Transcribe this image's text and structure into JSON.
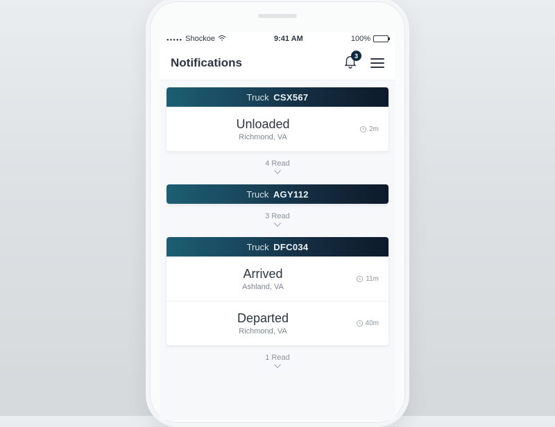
{
  "statusbar": {
    "carrier": "Shockoe",
    "time": "9:41 AM",
    "battery": "100%"
  },
  "nav": {
    "title": "Notifications",
    "badge": "3"
  },
  "truck_prefix": "Truck",
  "groups": [
    {
      "code": "CSX567",
      "items": [
        {
          "status": "Unloaded",
          "location": "Richmond, VA",
          "time": "2m"
        }
      ],
      "read": "4 Read"
    },
    {
      "code": "AGY112",
      "items": [],
      "read": "3 Read"
    },
    {
      "code": "DFC034",
      "items": [
        {
          "status": "Arrived",
          "location": "Ashland, VA",
          "time": "11m"
        },
        {
          "status": "Departed",
          "location": "Richmond, VA",
          "time": "40m"
        }
      ],
      "read": "1 Read"
    }
  ]
}
